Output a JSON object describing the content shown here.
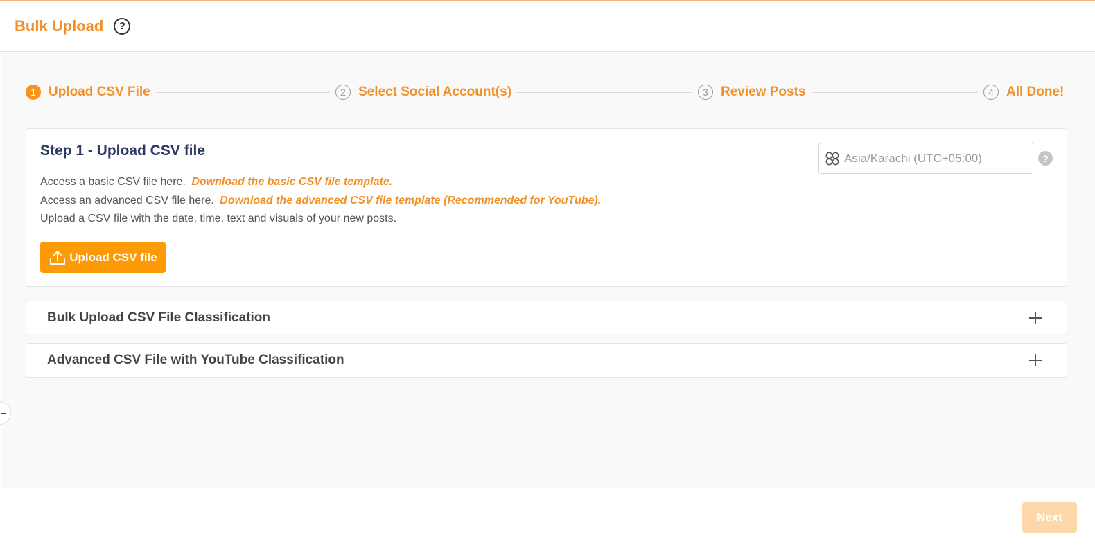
{
  "header": {
    "title": "Bulk Upload",
    "help_icon": "help-circle-icon"
  },
  "stepper": {
    "steps": [
      {
        "number": "1",
        "label": "Upload CSV File",
        "active": true
      },
      {
        "number": "2",
        "label": "Select Social Account(s)",
        "active": false
      },
      {
        "number": "3",
        "label": "Review Posts",
        "active": false
      },
      {
        "number": "4",
        "label": "All Done!",
        "active": false
      }
    ]
  },
  "upload_card": {
    "title": "Step 1 - Upload CSV file",
    "basic_prefix": "Access a basic CSV file here.",
    "basic_link": "Download the basic CSV file template.",
    "advanced_prefix": "Access an advanced CSV file here.",
    "advanced_link": "Download the advanced CSV file template (Recommended for YouTube).",
    "instructions": "Upload a CSV file with the date, time, text and visuals of your new posts.",
    "upload_button_label": "Upload CSV file",
    "timezone": {
      "value": "Asia/Karachi (UTC+05:00)",
      "icon": "globe-icon"
    },
    "timezone_help": "?"
  },
  "accordions": [
    {
      "title": "Bulk Upload CSV File Classification"
    },
    {
      "title": "Advanced CSV File with YouTube Classification"
    }
  ],
  "footer": {
    "next_label": "Next"
  },
  "colors": {
    "brand_orange": "#f39025",
    "button_orange": "#fd9a08",
    "title_navy": "#2c3a63",
    "next_disabled": "#fdd7a9"
  }
}
